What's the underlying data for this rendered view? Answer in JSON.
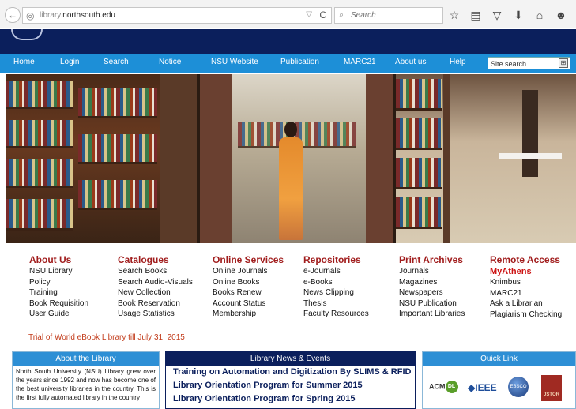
{
  "browser": {
    "url_dim": "library.",
    "url_main": "northsouth.edu",
    "search_placeholder": "Search",
    "back_glyph": "←",
    "reload_glyph": "C",
    "dropdown_glyph": "▽",
    "icons": [
      "star-icon",
      "reading-list-icon",
      "pocket-icon",
      "download-icon",
      "home-icon",
      "chat-icon"
    ]
  },
  "nav": {
    "items": [
      "Home",
      "Login",
      "Search",
      "Notice",
      "NSU Website",
      "Publication",
      "MARC21",
      "About us",
      "Help"
    ],
    "site_search_value": "Site search...",
    "go_glyph": "⊞"
  },
  "columns": [
    {
      "heading": "About Us",
      "links": [
        "NSU Library",
        "Policy",
        "Training",
        "Book Requisition",
        "User Guide"
      ]
    },
    {
      "heading": "Catalogues",
      "links": [
        "Search Books",
        "Search Audio-Visuals",
        "New Collection",
        "Book Reservation",
        "Usage Statistics"
      ]
    },
    {
      "heading": "Online Services",
      "links": [
        "Online Journals",
        "Online Books",
        "Books Renew",
        "Account Status",
        "Membership"
      ]
    },
    {
      "heading": "Repositories",
      "links": [
        "e-Journals",
        "e-Books",
        "News Clipping",
        "Thesis",
        "Faculty Resources"
      ]
    },
    {
      "heading": "Print Archives",
      "links": [
        "Journals",
        "Magazines",
        "Newspapers",
        "NSU Publication",
        "Important Libraries"
      ]
    },
    {
      "heading": "Remote Access",
      "subheading": "MyAthens",
      "links": [
        "Knimbus",
        "MARC21",
        "Ask a Librarian",
        "Plagiarism Checking"
      ]
    }
  ],
  "notice": "Trial of World eBook Library till July 31, 2015",
  "about": {
    "title": "About the Library",
    "text": "North South University (NSU) Library grew over the years since 1992 and now has become one of the best university libraries in the country. This is the first fully automated library in the country"
  },
  "news": {
    "title": "Library News & Events",
    "items": [
      "Training on Automation and Digitization By SLIMS & RFID",
      "Library Orientation Program for Summer 2015",
      "Library Orientation Program for Spring 2015"
    ]
  },
  "quick_link": {
    "title": "Quick Link",
    "acm": "ACM",
    "acm_dl": "DL",
    "ieee": "◆IEEE",
    "ebsco": "EBSCO",
    "jstor": "JSTOR"
  },
  "colors": {
    "header_navy": "#0b1f5c",
    "nav_blue": "#1d8fd7",
    "heading_red": "#a11d1d",
    "notice_orange": "#c23b1a"
  }
}
